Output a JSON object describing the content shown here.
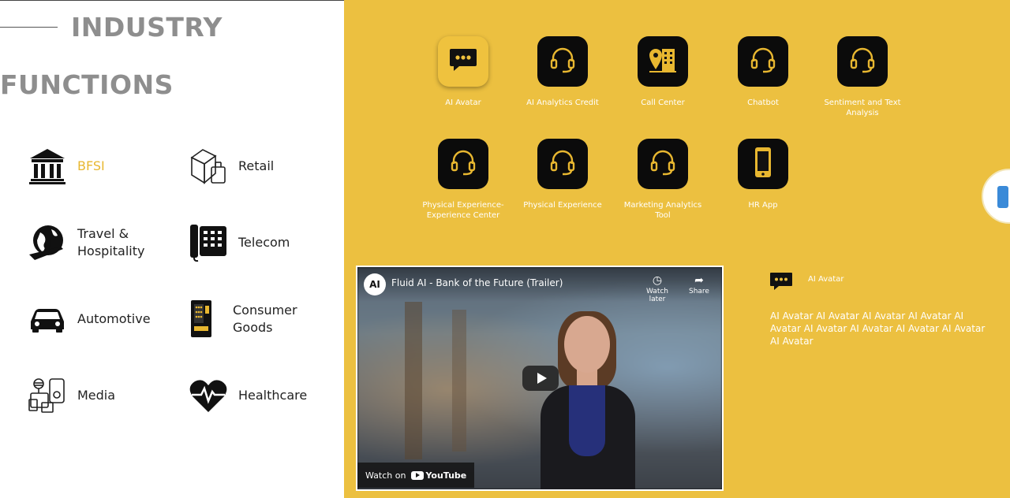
{
  "headings": {
    "industry": "INDUSTRY",
    "functions": "FUNCTIONS"
  },
  "industries": [
    {
      "label": "BFSI",
      "icon": "bank-icon",
      "active": true
    },
    {
      "label": "Retail",
      "icon": "boxes-icon"
    },
    {
      "label_line1": "Travel &",
      "label_line2": "Hospitality",
      "icon": "globe-plane-icon"
    },
    {
      "label": "Telecom",
      "icon": "telephone-icon"
    },
    {
      "label": "Automotive",
      "icon": "car-icon"
    },
    {
      "label_line1": "Consumer",
      "label_line2": "Goods",
      "icon": "vending-machine-icon"
    },
    {
      "label": "Media",
      "icon": "media-devices-icon"
    },
    {
      "label": "Healthcare",
      "icon": "heartbeat-icon"
    }
  ],
  "functions": [
    {
      "label": "AI Avatar",
      "icon": "chat-bubble-icon",
      "selected": true
    },
    {
      "label": "AI Analytics Credit",
      "icon": "headset-icon"
    },
    {
      "label": "Call Center",
      "icon": "location-building-icon"
    },
    {
      "label": "Chatbot",
      "icon": "headset-icon"
    },
    {
      "label_line1": "Sentiment and Text",
      "label_line2": "Analysis",
      "icon": "headset-icon"
    },
    {
      "label_line1": "Physical Experience-",
      "label_line2": "Experience Center",
      "icon": "headset-icon"
    },
    {
      "label": "Physical Experience",
      "icon": "headset-icon"
    },
    {
      "label_line1": "Marketing Analytics",
      "label_line2": "Tool",
      "icon": "headset-icon"
    },
    {
      "label": "HR App",
      "icon": "smartphone-icon"
    }
  ],
  "video": {
    "logo": "AI",
    "title": "Fluid AI - Bank of the Future (Trailer)",
    "watch_later": "Watch later",
    "share": "Share",
    "watch_on": "Watch on",
    "youtube": "YouTube"
  },
  "detail": {
    "title": "AI Avatar",
    "description": "AI Avatar AI Avatar AI Avatar AI Avatar AI Avatar AI Avatar AI Avatar AI Avatar AI Avatar AI Avatar"
  },
  "colors": {
    "accent": "#ecc040",
    "tile": "#0b0b0b",
    "heading": "#8e8e8e"
  }
}
